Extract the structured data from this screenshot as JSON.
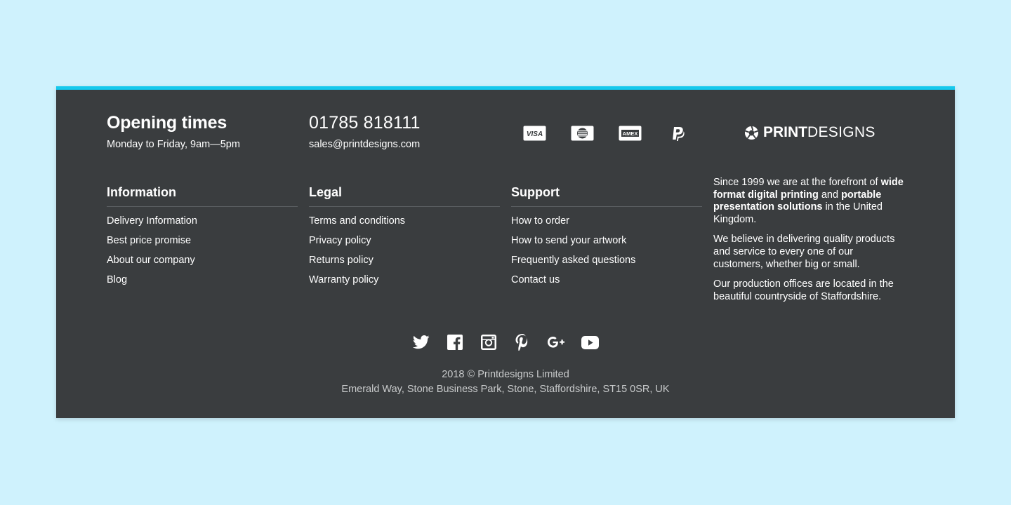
{
  "opening": {
    "title": "Opening times",
    "hours": "Monday to Friday, 9am—5pm"
  },
  "contact": {
    "phone": "01785 818111",
    "email": "sales@printdesigns.com"
  },
  "payments": [
    {
      "icon": "visa-icon",
      "label": "VISA"
    },
    {
      "icon": "mastercard-icon",
      "label": ""
    },
    {
      "icon": "amex-icon",
      "label": "AMEX"
    },
    {
      "icon": "paypal-icon",
      "label": ""
    }
  ],
  "logo": {
    "bold": "PRINT",
    "light": "DESIGNS"
  },
  "columns": [
    {
      "title": "Information",
      "links": [
        "Delivery Information",
        "Best price promise",
        "About our company",
        "Blog"
      ]
    },
    {
      "title": "Legal",
      "links": [
        "Terms and conditions",
        "Privacy policy",
        "Returns policy",
        "Warranty policy"
      ]
    },
    {
      "title": "Support",
      "links": [
        "How to order",
        "How to send your artwork",
        "Frequently asked questions",
        "Contact us"
      ]
    }
  ],
  "about": {
    "p1_a": "Since 1999 we are at the forefront of ",
    "p1_b": "wide format digital printing",
    "p1_c": " and ",
    "p1_d": "portable presentation solutions",
    "p1_e": " in the United Kingdom.",
    "p2": "We believe in delivering quality products and service to every one of our customers, whether big or small.",
    "p3": "Our production offices are located in the beautiful countryside of Staffordshire."
  },
  "social": [
    "twitter-icon",
    "facebook-icon",
    "instagram-icon",
    "pinterest-icon",
    "google-plus-icon",
    "youtube-icon"
  ],
  "copyright": "2018 © Printdesigns Limited",
  "address": "Emerald Way, Stone Business Park, Stone, Staffordshire, ST15 0SR, UK",
  "colors": {
    "page_bg": "#cff2fd",
    "footer_bg": "#3a3d3f",
    "accent": "#16c9ed",
    "muted_text": "#c9cbcc"
  }
}
